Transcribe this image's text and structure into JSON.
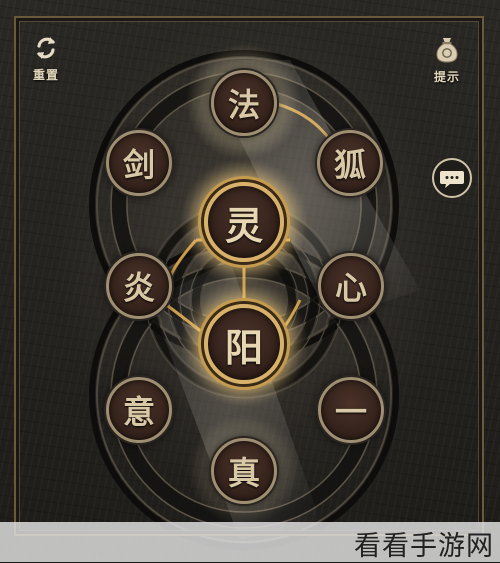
{
  "toolbar": {
    "reset_label": "重置",
    "hint_label": "提示"
  },
  "icons": {
    "reset": "rotate-arrows-icon",
    "hint": "money-bag-icon",
    "chat": "speech-bubble-icon"
  },
  "puzzle": {
    "nodes": [
      {
        "char": "法",
        "lit": false
      },
      {
        "char": "剑",
        "lit": false
      },
      {
        "char": "狐",
        "lit": false
      },
      {
        "char": "灵",
        "lit": true
      },
      {
        "char": "炎",
        "lit": false
      },
      {
        "char": "心",
        "lit": false
      },
      {
        "char": "阳",
        "lit": true
      },
      {
        "char": "意",
        "lit": false
      },
      {
        "char": "一",
        "lit": false
      },
      {
        "char": "真",
        "lit": false
      }
    ]
  },
  "watermark": {
    "text": "看看手游网"
  },
  "colors": {
    "board": "#24221f",
    "gold": "#c59b4f",
    "node_fill": "#35231c",
    "glow": "#ffd278"
  }
}
